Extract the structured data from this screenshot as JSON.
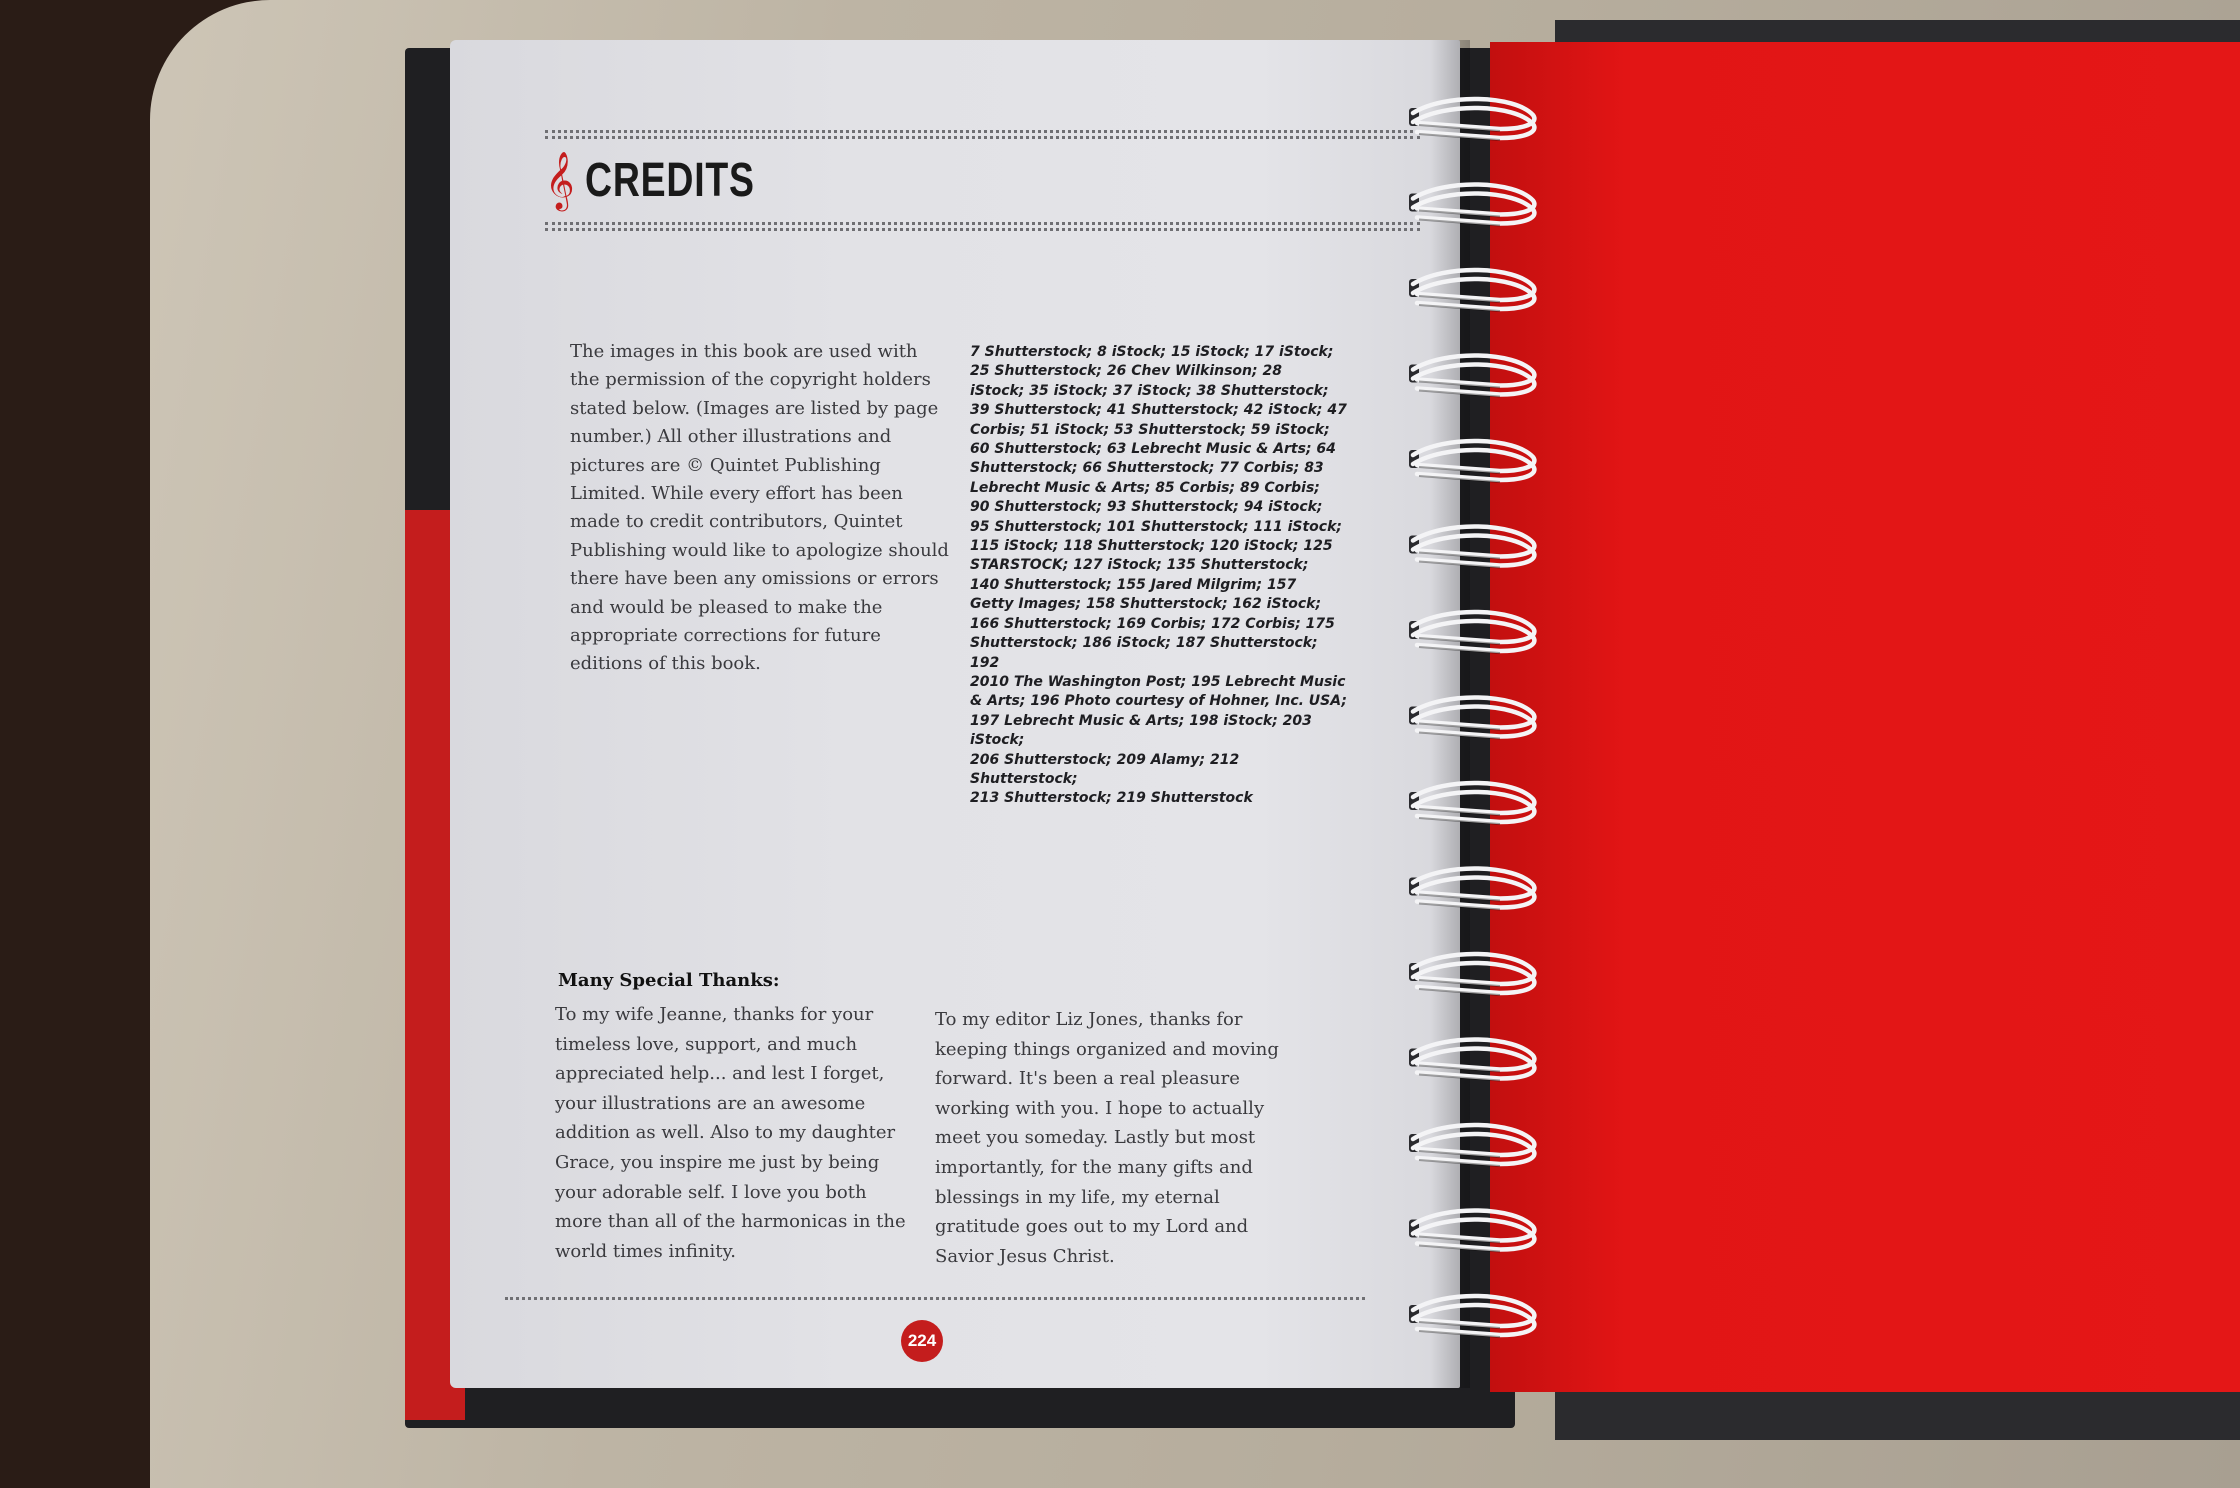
{
  "page": {
    "title": "CREDITS",
    "clef_glyph": "𝄞",
    "intro": "The images in this book are used with the permission of the copyright holders stated below. (Images are listed by page number.) All other illustrations and pictures are © Quintet Publishing Limited. While every effort has been made to credit contributors, Quintet Publishing would like to apologize should there have been any omissions or errors and would be pleased to make the appropriate corrections for future editions of this book.",
    "credits_lines": [
      "7 Shutterstock; 8 iStock; 15 iStock; 17 iStock;",
      "25 Shutterstock; 26 Chev Wilkinson; 28",
      "iStock; 35 iStock; 37 iStock; 38 Shutterstock;",
      "39 Shutterstock; 41 Shutterstock; 42 iStock; 47",
      "Corbis; 51 iStock; 53 Shutterstock; 59 iStock;",
      "60 Shutterstock; 63 Lebrecht Music & Arts; 64",
      "Shutterstock; 66 Shutterstock; 77 Corbis; 83",
      "Lebrecht Music & Arts; 85 Corbis; 89 Corbis;",
      "90 Shutterstock; 93 Shutterstock; 94 iStock;",
      "95 Shutterstock; 101 Shutterstock; 111 iStock;",
      "115 iStock; 118 Shutterstock; 120 iStock; 125",
      "STARSTOCK; 127 iStock; 135 Shutterstock;",
      "140 Shutterstock; 155 Jared Milgrim; 157",
      "Getty Images; 158 Shutterstock; 162 iStock;",
      "166 Shutterstock; 169 Corbis; 172 Corbis; 175",
      "Shutterstock; 186 iStock; 187 Shutterstock; 192",
      "2010 The Washington Post; 195 Lebrecht Music",
      "& Arts; 196 Photo courtesy of Hohner, Inc. USA;",
      "197 Lebrecht Music & Arts; 198 iStock; 203 iStock;",
      "206 Shutterstock; 209 Alamy; 212 Shutterstock;",
      "213 Shutterstock; 219 Shutterstock"
    ],
    "thanks_heading": "Many Special Thanks:",
    "thanks_left": "To my wife Jeanne, thanks for your timeless love, support, and much appreciated help... and lest I forget, your illustrations are an awesome addition as well. Also to my daughter Grace, you inspire me just by being your adorable self. I love you both more than all of the harmonicas in the world times infinity.",
    "thanks_right": "To my editor Liz Jones, thanks for keeping things organized and moving forward. It's been a real pleasure working with you. I hope to actually meet you someday. Lastly but most importantly, for the many gifts and blessings in my life, my eternal gratitude goes out to my Lord and Savior Jesus Christ.",
    "page_number": "224"
  },
  "colors": {
    "accent_red": "#c41d1d",
    "cover_red": "#e21515",
    "page_gray": "#e2e2e6",
    "text_dark": "#1e1e22"
  }
}
